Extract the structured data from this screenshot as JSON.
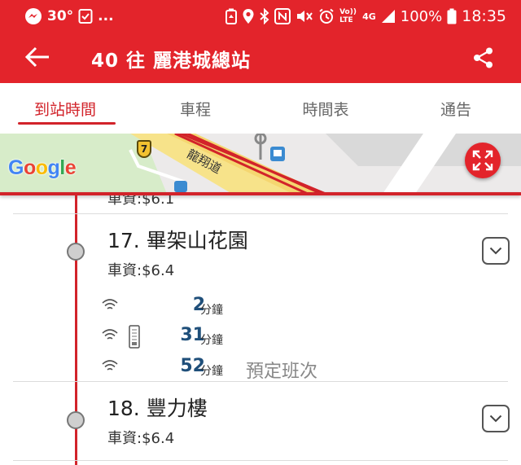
{
  "status_bar": {
    "temperature": "30°",
    "more": "...",
    "network": "4G",
    "volte": "Vo)) LTE",
    "battery": "100%",
    "time": "18:35",
    "icons": [
      "messenger-icon",
      "checkbox-icon",
      "battery-saver-icon",
      "location-icon",
      "bluetooth-icon",
      "nfc-icon",
      "mute-icon",
      "alarm-icon",
      "signal-icon",
      "battery-icon"
    ]
  },
  "app_bar": {
    "title": "40 往 麗港城總站",
    "back_icon": "arrow-left-icon",
    "share_icon": "share-icon"
  },
  "tabs": [
    {
      "label": "到站時間",
      "active": true
    },
    {
      "label": "車程",
      "active": false
    },
    {
      "label": "時間表",
      "active": false
    },
    {
      "label": "通告",
      "active": false
    }
  ],
  "map": {
    "road_shield": "7",
    "road_name": "龍翔道",
    "logo": {
      "g1": "G",
      "o1": "o",
      "o2": "o",
      "g2": "g",
      "l": "l",
      "e": "e"
    },
    "expand_icon": "fullscreen-icon"
  },
  "stops": {
    "previous_fare_partial": "車資:$6.1",
    "items": [
      {
        "name": "17. 畢架山花園",
        "fare": "車資:$6.4",
        "etas": [
          {
            "value": "2",
            "unit": "分鐘",
            "note": "",
            "icon": "wifi-icon",
            "device": false
          },
          {
            "value": "31",
            "unit": "分鐘",
            "note": "",
            "icon": "wifi-icon",
            "device": true
          },
          {
            "value": "52",
            "unit": "分鐘",
            "note": "預定班次",
            "icon": "wifi-icon",
            "device": false
          }
        ]
      },
      {
        "name": "18. 豐力樓",
        "fare": "車資:$6.4",
        "etas": []
      }
    ]
  },
  "colors": {
    "brand_red": "#e3242b",
    "tab_active": "#d2232a",
    "eta_blue": "#1f4f7a"
  }
}
